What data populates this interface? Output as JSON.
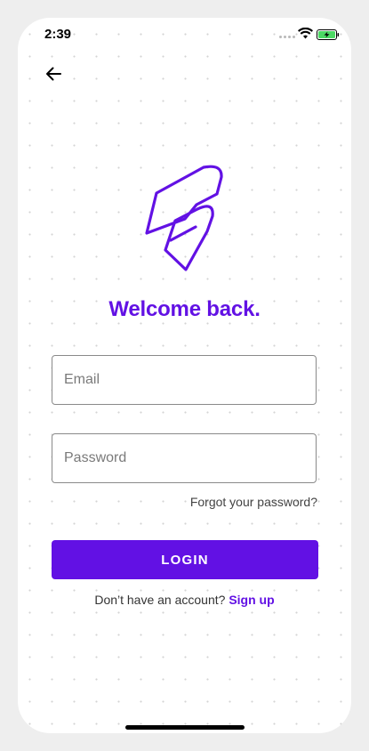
{
  "status_bar": {
    "time": "2:39",
    "icons": [
      "cellular-dots-icon",
      "wifi-icon",
      "battery-charging-icon"
    ]
  },
  "nav": {
    "back_icon": "arrow-left-icon"
  },
  "brand": {
    "logo_icon": "folded-ribbon-logo-icon",
    "accent_color": "#6211e4"
  },
  "heading": "Welcome back.",
  "form": {
    "email_placeholder": "Email",
    "email_value": "",
    "password_placeholder": "Password",
    "password_value": "",
    "forgot_label": "Forgot your password?",
    "login_label": "LOGIN"
  },
  "signup": {
    "prompt": "Don’t have an account?",
    "link_label": "Sign up"
  }
}
